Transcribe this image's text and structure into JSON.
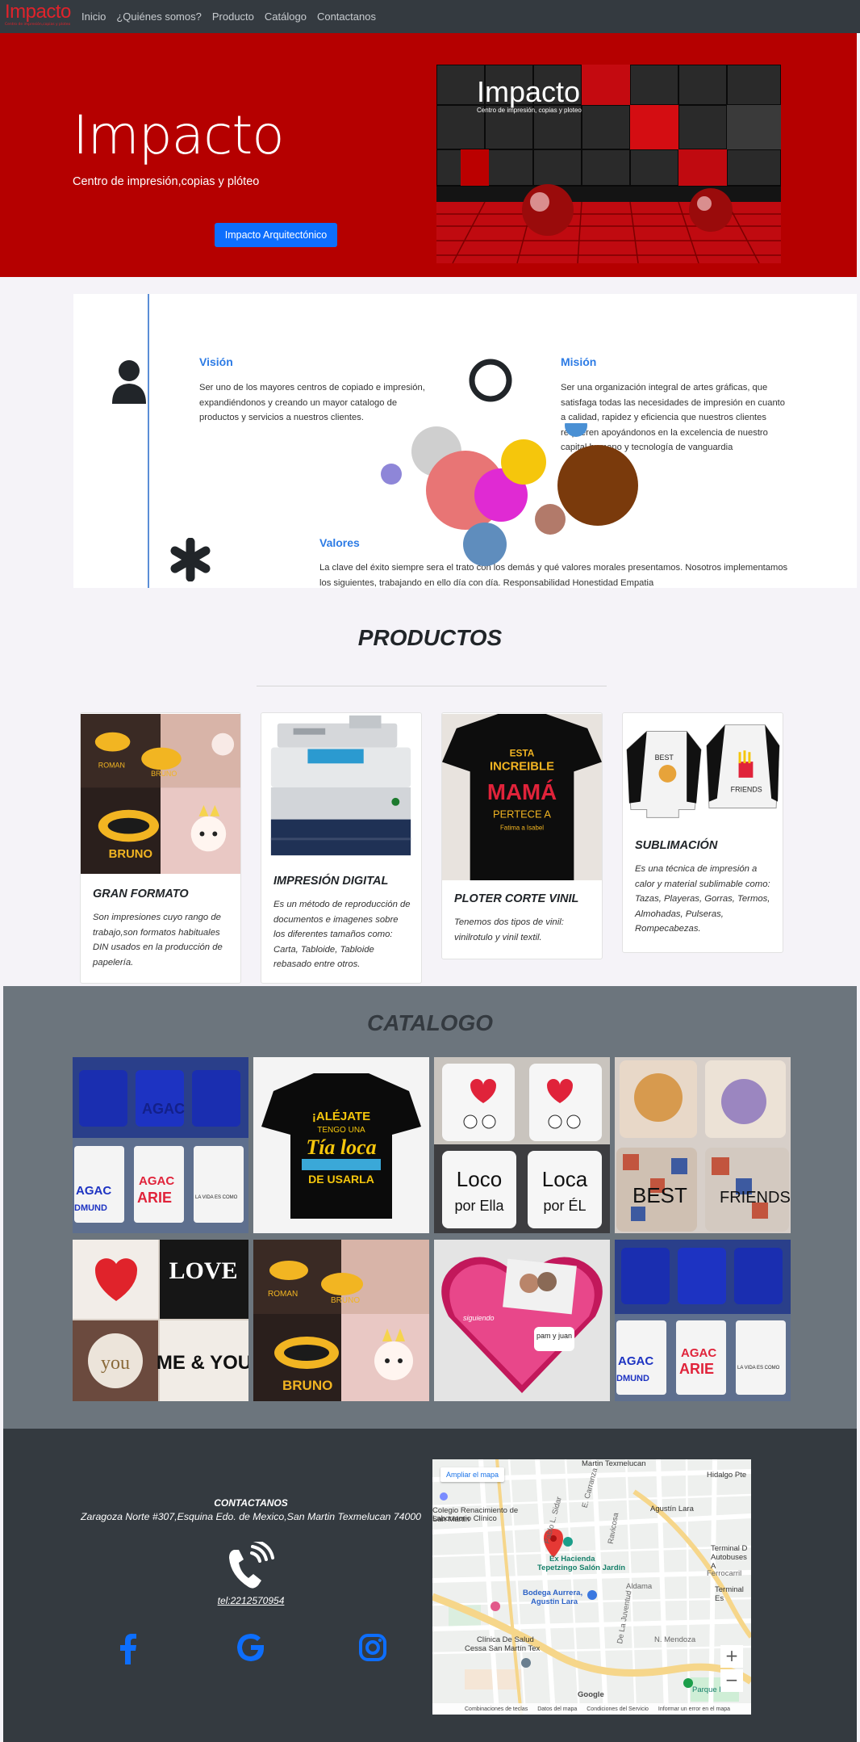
{
  "navbar": {
    "brand": "Impacto",
    "brand_sub": "Centro de impresión,copias y ploteo",
    "links": [
      "Inicio",
      "¿Quiénes somos?",
      "Producto",
      "Catálogo",
      "Contactanos"
    ]
  },
  "hero": {
    "title": "Impacto",
    "subtitle": "Centro de impresión,copias y plóteo",
    "button": "Impacto Arquitectónico",
    "image_logo": "Impacto",
    "image_tagline": "Centro de impresión, copias y ploteo"
  },
  "about": {
    "vision_title": "Visión",
    "vision_text": "Ser uno de los mayores centros de copiado e impresión, expandiéndonos y creando un mayor catalogo de productos y servicios a nuestros clientes.",
    "mision_title": "Misión",
    "mision_text": "Ser una organización integral de artes gráficas, que satisfaga todas las necesidades de impresión en cuanto a calidad, rapidez y eficiencia que nuestros clientes requieren apoyándonos en la excelencia de nuestro capital humano y tecnología de vanguardia",
    "valores_title": "Valores",
    "valores_text": " La clave del éxito siempre sera el trato con los demás y qué valores morales presentamos. Nosotros implementamos los siguientes, trabajando en ello día con día. Responsabilidad Honestidad Empatia",
    "accent": "#2c7be5"
  },
  "productos": {
    "title": "PRODUCTOS",
    "cards": [
      {
        "title": "GRAN FORMATO",
        "text": "Son impresiones cuyo rango de trabajo,son formatos  habituales DIN usados en la producción de  papelería."
      },
      {
        "title": "IMPRESIÓN DIGITAL",
        "text": "Es un método de reproducción de documentos e imagenes sobre los diferentes tamaños como: Carta, Tabloide, Tabloide rebasado entre otros."
      },
      {
        "title": "PLOTER CORTE VINIL",
        "text": "Tenemos dos tipos de vinil: vinilrotulo y vinil textil."
      },
      {
        "title": "SUBLIMACIÓN",
        "text": "Es una técnica de impresión a calor y material sublimable como: Tazas, Playeras, Gorras, Termos, Almohadas, Pulseras, Rompecabezas."
      }
    ],
    "img_text": {
      "bag1": "ROMAN",
      "bag2": "BRUNO",
      "bag3": "BRUNO",
      "shirt_line1": "ESTA",
      "shirt_line2": "INCREIBLE",
      "shirt_line3": "MAMÁ",
      "shirt_line4": "PERTECE A",
      "shirt_line5": "Fatima a Isabel",
      "sub_best": "BEST",
      "sub_friends": "FRIENDS"
    }
  },
  "catalogo": {
    "title": "CATALOGO",
    "tile_text": {
      "mug_agac": "AGAC",
      "mug_arie": "ARIE",
      "mug_dmund": "DMUND",
      "mug_vida": "LA VIDA ES COMO",
      "shirt1": "¡ALÉJATE",
      "shirt2": "TENGO UNA",
      "shirt3": "Tía loca",
      "shirt4": "DE USARLA",
      "loco": "Loco",
      "por_ella": "por Ella",
      "loca": "Loca",
      "por_el": "por ÉL",
      "best": "BEST",
      "friends": "FRIENDS",
      "love": "LOVE",
      "you": "you",
      "me_you": "ME & YOU",
      "roman": "ROMAN",
      "bruno": "BRUNO",
      "pam_juan": "pam y juan",
      "heart_text": "siguiendo"
    }
  },
  "footer": {
    "title": "CONTACTANOS",
    "address": "Zaragoza Norte #307,Esquina Edo. de Mexico,San Martin Texmelucan 74000",
    "tel_label": "tel:",
    "tel": "2212570954",
    "social": [
      "facebook-icon",
      "google-icon",
      "instagram-icon"
    ],
    "social_color": "#0d6efd"
  },
  "map": {
    "button": "Ampliar el mapa",
    "labels": [
      "Martin Texmelucan",
      "Hidalgo Pte",
      "Colegio Renacimiento de San Martin",
      "Laboratorio Clínico",
      "Agustín Lara",
      "Ex Hacienda",
      "Tepetzingo Salón Jardín",
      "Bodega Aurrera,",
      "Agustin Lara",
      "Terminal D",
      "Autobuses A",
      "Ferrocarril",
      "Terminal Es",
      "Aldama",
      "Clínica De Salud",
      "Cessa San Martín Tex",
      "N. Mendoza",
      "Parque Ec",
      "E. Carranza",
      "Pablo L. Sidar",
      "Ravicosa",
      "De La Juventud",
      "Google"
    ],
    "footer": [
      "Combinaciones de teclas",
      "Datos del mapa",
      "Condiciones del Servicio",
      "Informar un error en el mapa"
    ]
  }
}
